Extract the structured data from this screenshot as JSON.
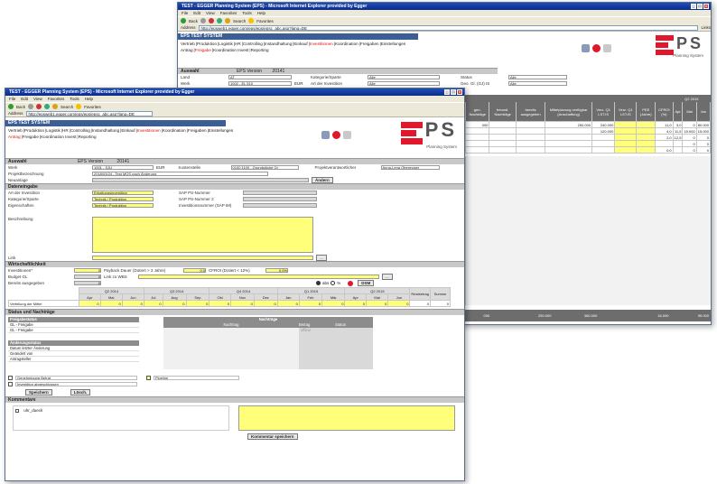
{
  "back_window": {
    "title": "TEST - EGGER Planning System (EPS) - Microsoft Internet Explorer provided by Egger",
    "menu": [
      "File",
      "Edit",
      "View",
      "Favorites",
      "Tools",
      "Help"
    ],
    "toolbar": [
      "Back",
      "Search",
      "Favorites"
    ],
    "address_label": "Address",
    "url": "http://epsweb1.egger.com/eps/eps/epsc_abc.asp?lang=DE",
    "go_label": "Links",
    "tooltip": "Back to EGGER Planning System (EPS)",
    "system_label": "EPS TEST SYSTEM",
    "nav_row1": [
      "Vertrieb",
      "Produktion",
      "Logistik",
      "HR",
      "Controlling",
      "Instandhaltung",
      "Einkauf",
      "Investitionen",
      "Koordination",
      "Freigaben",
      "Einstellungen"
    ],
    "nav_row2": [
      "Antrag",
      "Freigabe",
      "Koordination Invest",
      "Reporting"
    ],
    "grid_header_group": "Q2 2015",
    "grid_columns": [
      "gen. Nachträge",
      "freundl. Nachträge",
      "bereits ausgegeben",
      "Mittelplanung verfügbar (Anschaffung)",
      "Verz. Q1 LST.IS",
      "Verz. Q1 LST.IS",
      "PEE (Jahre)",
      "CFROI (%)",
      "Apr",
      "Mai",
      "Jun"
    ],
    "grid_rows": [
      [
        "000",
        "",
        "",
        "250.000",
        "240.000",
        "",
        "",
        "11,0",
        "3,0",
        "0",
        "80.000",
        "0"
      ],
      [
        "",
        "",
        "",
        "",
        "120.000",
        "",
        "",
        "4,0",
        "11,5",
        "15.000",
        "15.000",
        "10.000"
      ],
      [
        "",
        "",
        "",
        "",
        "",
        "",
        "",
        "2,0",
        "12,5",
        "0",
        "0",
        "0"
      ],
      [
        "",
        "",
        "",
        "",
        "",
        "",
        "",
        "",
        "",
        "0",
        "0",
        "0"
      ],
      [
        "",
        "",
        "",
        "",
        "",
        "",
        "",
        "0,0",
        "",
        "0",
        "0",
        "0"
      ]
    ],
    "grid_total": [
      "000",
      "",
      "",
      "250.000",
      "360.000",
      "",
      "",
      "",
      "",
      "16.000",
      "95.000",
      "10.000"
    ],
    "logo_ps": "PS",
    "logo_sub": "Planning System",
    "auswahl_label": "Auswahl",
    "eps_version_label": "EPS Version",
    "eps_version_value": "20141",
    "filter_rows": [
      {
        "label": "Land",
        "value": "AT",
        "label2": "Kategorie/Sparte",
        "value2": "Alle",
        "label3": "Status",
        "value3": "Alle"
      },
      {
        "label": "Werk",
        "value": "1002 - EL 510",
        "label2": "Art der Investition",
        "value2": "Alle",
        "label3": "Geo. Gl. (GJ) IS",
        "value3": "Alle"
      }
    ],
    "filter_extra": "EUR"
  },
  "front_window": {
    "title": "TEST - EGGER Planning System (EPS) - Microsoft Internet Explorer provided by Egger",
    "menu": [
      "File",
      "Edit",
      "View",
      "Favorites",
      "Tools",
      "Help"
    ],
    "toolbar": [
      "Back",
      "Search",
      "Favorites"
    ],
    "address_label": "Address",
    "url": "http://epsweb1.egger.com/eps/eps/epsc_abc.asp?lang=DE",
    "system_label": "EPS TEST SYSTEM",
    "nav_row1": [
      "Vertrieb",
      "Produktion",
      "Logistik",
      "HR",
      "Controlling",
      "Instandhaltung",
      "Einkauf",
      "Investitionen",
      "Koordination",
      "Freigaben",
      "Einstellungen"
    ],
    "nav_row2": [
      "Antrag",
      "Freigabe",
      "Koordination Invest",
      "Reporting"
    ],
    "logo_ps": "PS",
    "logo_sub": "Planning System",
    "auswahl": {
      "label": "Auswahl",
      "eps_version_label": "EPS Version",
      "eps_version_value": "20141",
      "werk_label": "Werk",
      "werk_value": "1001 - SJU",
      "currency": "EUR",
      "kostenstelle_label": "Kostenstelle",
      "kostenstelle_value": "0100 1100 - Grundstücke Gr",
      "projektverantw_label": "Projektverantwortlicher",
      "projektverantw_value": "Anna-Lena Obermoser",
      "projekt_label": "Projektbezeichnung",
      "projekt_value": "2018/03/24 - Test MOS nach Änderung",
      "neuanlage_label": "Neuanlage",
      "aendern_button": "Ändern"
    },
    "dateneingabe": {
      "label": "Dateneingabe",
      "fields_left": [
        {
          "label": "Art der Investition",
          "value": "Erhaltungsinvestition"
        },
        {
          "label": "Kategorie/Sparte",
          "value": "Technik / Produktion"
        },
        {
          "label": "Eigenschaften",
          "value": "Technik / Produktion"
        }
      ],
      "fields_right": [
        {
          "label": "SAP PS-Nummer",
          "value": ""
        },
        {
          "label": "SAP PS-Nummer 2",
          "value": ""
        },
        {
          "label": "Investitionsnummer (SAP IM)",
          "value": ""
        }
      ],
      "beschreibung_label": "Beschreibung",
      "link_label": "Link",
      "link_button": "..."
    },
    "wirtschaftlichkeit": {
      "label": "Wirtschaftlichkeit",
      "invest_label": "Investitionen*",
      "invest_value": "0",
      "payback_label": "Payback Dauer (Dotiert > 3 Jahre)",
      "payback_value": "0,0",
      "cfroi_label": "CFROI (Dotiert < 12%)",
      "cfroi_value": "0,0%",
      "budget_label": "Budget GL",
      "budget_value": "0",
      "link_wbs_label": "Link zu WBS",
      "link_wbs_button": "...",
      "bereits_label": "Bereits ausgegeben",
      "bereits_value": "0",
      "radio_abs": "abs",
      "radio_pct": "%",
      "dsm_label": "DSM",
      "quarters": [
        "Q2 2014",
        "Q3 2014",
        "Q4 2014",
        "Q1 2015",
        "Q2 2015"
      ],
      "months": [
        "Apr",
        "Mai",
        "Jun",
        "Jul",
        "Aug",
        "Sep",
        "Okt",
        "Nov",
        "Dez",
        "Jan",
        "Feb",
        "Mär",
        "Apr",
        "Mai",
        "Jun"
      ],
      "restbetrag_label": "Restbetrag",
      "summe_label": "Summe",
      "verteilung_label": "Verteilung der Mittel",
      "verteilung_values": [
        "0",
        "0",
        "0",
        "0",
        "0",
        "0",
        "0",
        "0",
        "0",
        "0",
        "0",
        "0",
        "0",
        "0",
        "0"
      ],
      "restbetrag_value": "0",
      "summe_value": "0"
    },
    "status": {
      "label": "Status und Nachträge",
      "freigabestatus_label": "Freigabestatus",
      "freigabe_rows": [
        "GL - Freigabe",
        "GL - Freigabe"
      ],
      "aenderung_label": "Änderungsstatus",
      "aenderung_rows": [
        "Datum letzter Änderung",
        "Geändert von",
        "Antragsteller"
      ],
      "nachtraege_head": "Nachträge",
      "nachtraege_cols": [
        "Nachtrag",
        "Betrag",
        "Status"
      ],
      "nachtraege_status": "offline",
      "check1": "Genehmigung Betrat",
      "check2": "Investition abgeschlossen",
      "check3": "Pipeline",
      "speichern_button": "Speichern",
      "loeschen_button": "Lösch."
    },
    "kommentare": {
      "label": "Kommentare",
      "user": "uhr_dueck",
      "save_button": "Kommentar speichern"
    }
  },
  "colors": {
    "accent_red": "#e2172c",
    "field_yellow": "#ffff7a",
    "titlebar_blue": "#0a2a8c",
    "system_bar": "#3b5e94"
  }
}
